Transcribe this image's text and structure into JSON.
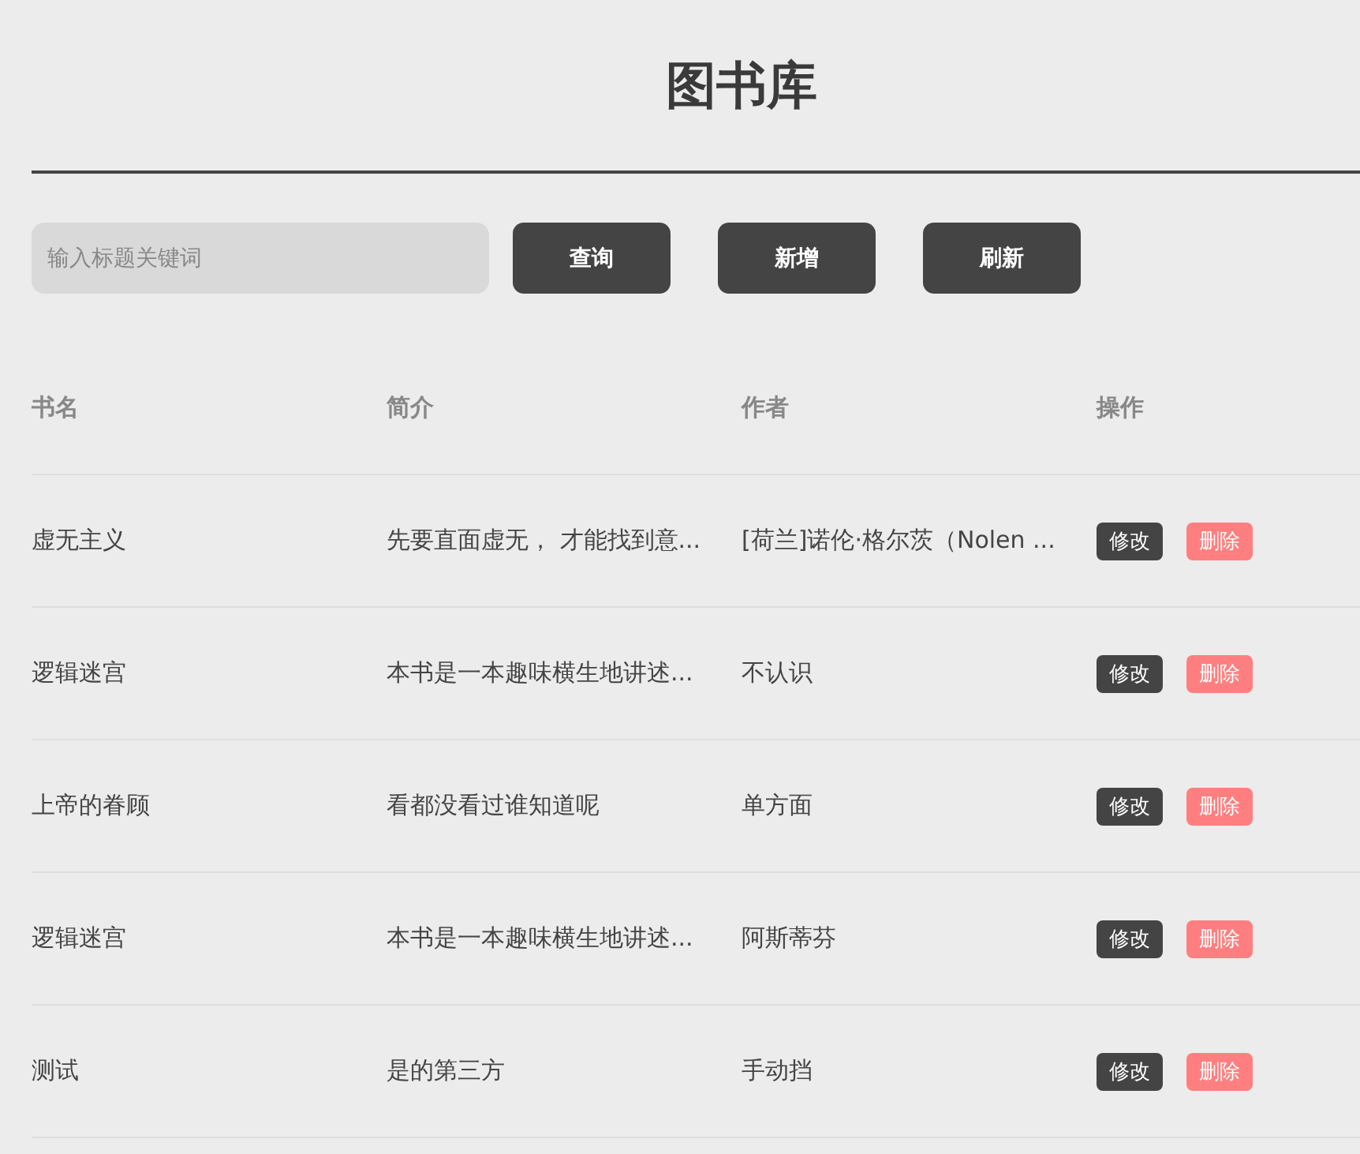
{
  "title": "图书库",
  "search": {
    "placeholder": "输入标题关键词"
  },
  "buttons": [
    "查询",
    "新增",
    "刷新"
  ],
  "table": {
    "columns": [
      "书名",
      "简介",
      "作者",
      "操作"
    ],
    "rows": [
      {
        "cells": [
          "虚无主义",
          "先要直面虚无， 才能找到意...",
          "[荷兰]诺伦·格尔茨（Nolen ..."
        ],
        "actions": [
          "修改",
          "删除"
        ]
      },
      {
        "cells": [
          "逻辑迷宫",
          "本书是一本趣味横生地讲述...",
          "不认识"
        ],
        "actions": [
          "修改",
          "删除"
        ]
      },
      {
        "cells": [
          "上帝的眷顾",
          "看都没看过谁知道呢",
          "单方面"
        ],
        "actions": [
          "修改",
          "删除"
        ]
      },
      {
        "cells": [
          "逻辑迷宫",
          "本书是一本趣味横生地讲述...",
          "阿斯蒂芬"
        ],
        "actions": [
          "修改",
          "删除"
        ]
      },
      {
        "cells": [
          "测试",
          "是的第三方",
          "手动挡"
        ],
        "actions": [
          "修改",
          "删除"
        ]
      }
    ]
  }
}
